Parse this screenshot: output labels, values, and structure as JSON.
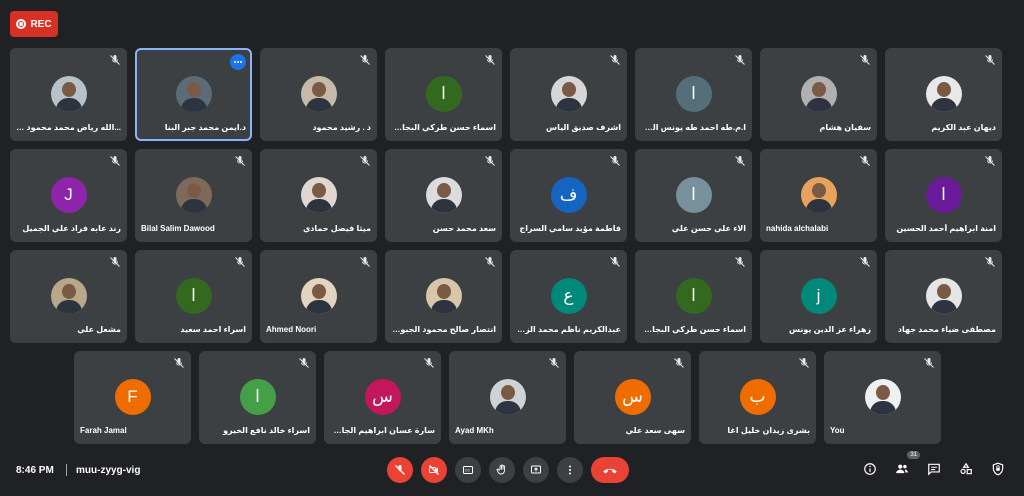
{
  "recording": {
    "label": "REC"
  },
  "rows": [
    [
      {
        "name": "...الله رياض محمد محمود الطوى",
        "avatar": {
          "type": "photo",
          "bg": "#b7c2c9"
        }
      },
      {
        "name": "د.ايمن محمد جبر البنا",
        "avatar": {
          "type": "photo",
          "bg": "#5b6b78"
        },
        "active": true
      },
      {
        "name": "د . رشيد محمود",
        "avatar": {
          "type": "photo",
          "bg": "#c5b9a8"
        }
      },
      {
        "name": "اسماء حسن طركي البجاري",
        "avatar": {
          "type": "letter",
          "letter": "ا",
          "bg": "#33691e"
        }
      },
      {
        "name": "اشرف صديق الياس",
        "avatar": {
          "type": "photo",
          "bg": "#d6d6d6"
        }
      },
      {
        "name": "ا.م.طه احمد طه يونس الطيار",
        "avatar": {
          "type": "letter",
          "letter": "ا",
          "bg": "#546e7a"
        }
      },
      {
        "name": "سفيان هشام",
        "avatar": {
          "type": "photo",
          "bg": "#b0b0b0"
        }
      },
      {
        "name": "ديهان عبد الكريم",
        "avatar": {
          "type": "photo",
          "bg": "#e8e8e8"
        }
      }
    ],
    [
      {
        "name": "رند عابه فراد علي الجميل",
        "avatar": {
          "type": "letter",
          "letter": "J",
          "bg": "#8e24aa"
        }
      },
      {
        "name": "Bilal Salim Dawood",
        "avatar": {
          "type": "photo",
          "bg": "#7d6a5b"
        }
      },
      {
        "name": "ميثا فيصل حمادي",
        "avatar": {
          "type": "photo",
          "bg": "#e0d8d0"
        }
      },
      {
        "name": "سعد محمد حسن",
        "avatar": {
          "type": "photo",
          "bg": "#dcdcdc"
        }
      },
      {
        "name": "فاطمة مؤيد سامي السراج",
        "avatar": {
          "type": "letter",
          "letter": "ف",
          "bg": "#1565c0"
        }
      },
      {
        "name": "الاء علي حسن علي",
        "avatar": {
          "type": "letter",
          "letter": "ا",
          "bg": "#78909c"
        }
      },
      {
        "name": "nahida alchalabi",
        "avatar": {
          "type": "photo",
          "bg": "#e7a25c"
        }
      },
      {
        "name": "امنة ابراهيم أحمد الحسين",
        "avatar": {
          "type": "letter",
          "letter": "ا",
          "bg": "#6a1b9a"
        }
      }
    ],
    [
      {
        "name": "مشعل علي",
        "avatar": {
          "type": "photo",
          "bg": "#b9a78a"
        }
      },
      {
        "name": "اسراء احمد سعيد",
        "avatar": {
          "type": "letter",
          "letter": "ا",
          "bg": "#33691e"
        }
      },
      {
        "name": "Ahmed Noori",
        "avatar": {
          "type": "photo",
          "bg": "#e2d4c0"
        }
      },
      {
        "name": "انتصار صالح محمود الجبوري",
        "avatar": {
          "type": "photo",
          "bg": "#d8c6a8"
        }
      },
      {
        "name": "عبدالكريم ناظم محمد الزهيري",
        "avatar": {
          "type": "letter",
          "letter": "ع",
          "bg": "#00897b"
        }
      },
      {
        "name": "اسماء حسن طركي البجاري",
        "avatar": {
          "type": "letter",
          "letter": "ا",
          "bg": "#33691e"
        }
      },
      {
        "name": "زهراء عز الدين يونس",
        "avatar": {
          "type": "letter",
          "letter": "j",
          "bg": "#00897b"
        }
      },
      {
        "name": "مصطفى ضياء محمد جهاد",
        "avatar": {
          "type": "photo",
          "bg": "#e5e5e5"
        }
      }
    ],
    [
      {
        "name": "Farah Jamal",
        "avatar": {
          "type": "letter",
          "letter": "F",
          "bg": "#ef6c00"
        }
      },
      {
        "name": "اسراء خالد نافع الخيرو",
        "avatar": {
          "type": "letter",
          "letter": "ا",
          "bg": "#43a047"
        }
      },
      {
        "name": "سارة عسان ابراهيم الجادرجي",
        "avatar": {
          "type": "letter",
          "letter": "س",
          "bg": "#c2185b"
        }
      },
      {
        "name": "Ayad MKh",
        "avatar": {
          "type": "photo",
          "bg": "#cfd3d6"
        }
      },
      {
        "name": "سهى سعد علي",
        "avatar": {
          "type": "letter",
          "letter": "س",
          "bg": "#ef6c00"
        }
      },
      {
        "name": "بشرى زيدان خليل اغا",
        "avatar": {
          "type": "letter",
          "letter": "ب",
          "bg": "#ef6c00"
        }
      },
      {
        "name": "You",
        "avatar": {
          "type": "photo",
          "bg": "#f0f0f0"
        }
      }
    ]
  ],
  "bottom": {
    "time": "8:46 PM",
    "meeting_code": "muu-zyyg-vig",
    "participants_count": "31"
  },
  "icons": {
    "mic_off": "mic-off-icon",
    "camera_off": "camera-off-icon",
    "captions": "captions-icon",
    "hand": "raise-hand-icon",
    "present": "present-icon",
    "more": "more-options-icon",
    "hangup": "hang-up-icon",
    "info": "info-icon",
    "people": "people-icon",
    "chat": "chat-icon",
    "activities": "activities-icon",
    "host_controls": "host-controls-icon"
  }
}
